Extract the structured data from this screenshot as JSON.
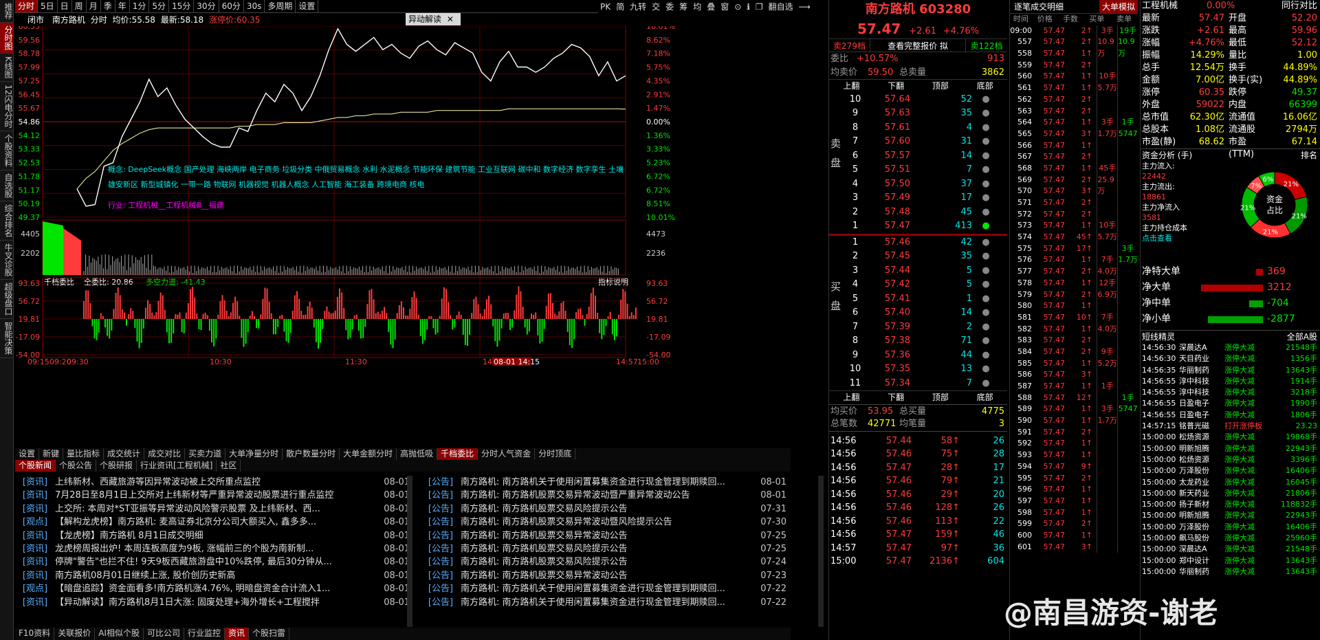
{
  "left_nav": [
    "推荐",
    "分时图",
    "K线图",
    "12闪电分时",
    "个股资料",
    "自选股",
    "综合排名",
    "牛叉诊股",
    "超级盘口",
    "智能决策"
  ],
  "toolbar": [
    "分时",
    "5日",
    "日",
    "周",
    "月",
    "季",
    "年",
    "1分",
    "5分",
    "15分",
    "30分",
    "60分",
    "30s",
    "多周期",
    "设置"
  ],
  "toolbar_right": [
    "PK",
    "简",
    "九转",
    "交",
    "委",
    "筹",
    "均",
    "叠",
    "窗",
    "⊙",
    "ℹ",
    "❐",
    "翻自选",
    "⟶"
  ],
  "chart_header": {
    "status": "闭市",
    "name": "南方路机",
    "mode": "分时",
    "avg_label": "均价:",
    "avg": "55.58",
    "latest_label": "最新:",
    "latest": "58.18",
    "limit": "涨停价:60.35",
    "tag": "异动解读"
  },
  "price_axis_left": [
    "60.35",
    "59.56",
    "58.78",
    "57.99",
    "57.25",
    "56.45",
    "55.67",
    "54.86",
    "54.12",
    "53.33",
    "52.53",
    "51.78",
    "51.17",
    "50.19",
    "49.37"
  ],
  "price_axis_right": [
    "10.01%",
    "8.62%",
    "7.18%",
    "5.75%",
    "4.35%",
    "2.91%",
    "1.47%",
    "0.00%",
    "1.36%",
    "3.33%",
    "5.23%",
    "6.72%",
    "6.72%",
    "8.51%",
    "10.01%"
  ],
  "vol_axis": [
    "4405",
    "2202"
  ],
  "vol_axis_right": [
    "4473",
    "2236"
  ],
  "concepts": "概念: DeepSeek概念  国产处理  海峡两岸  电子商务  垃圾分类  中俄贸易概念  水利  水泥概念  节能环保  建筑节能  工业互联网  碳中和  数字经济  数字孪生  土壤  雄安新区  新型城镇化  一带一路  物联网  机器视觉  机器人概念  人工智能  海工装备  跨境电商  核电",
  "industry": "行业: 工程机械__工程机械Ⅲ__福建",
  "indicator": {
    "title": "千档委比",
    "total": "全委比: 20.86",
    "airflow": "多空力道: -41.43",
    "help": "指标说明"
  },
  "ind_axis": [
    "93.63",
    "56.72",
    "19.81",
    "-17.09",
    "-54.00"
  ],
  "time_axis": [
    "09:15",
    "09:20",
    "09:30",
    "10:30",
    "11:30",
    "14:00",
    "14:57",
    "15:00"
  ],
  "time_hl": "08-01 14:15",
  "tabs_ind": [
    "设置",
    "新键",
    "量比指标",
    "成交统计",
    "成交对比",
    "买卖力道",
    "大单净量分时",
    "散户数量分时",
    "大单金额分时",
    "高抛低吸",
    "千档委比",
    "分时人气资金",
    "分时顶底"
  ],
  "tabs_news": [
    "个股新闻",
    "个股公告",
    "个股研报",
    "行业资讯[工程机械]",
    "社区"
  ],
  "news_left": [
    {
      "t": "资讯",
      "s": "上纬新材、西藏旅游等因异常波动被上交所重点监控",
      "d": "08-01"
    },
    {
      "t": "资讯",
      "s": "7月28日至8月1日上交所对上纬新材等严重异常波动股票进行重点监控",
      "d": "08-01"
    },
    {
      "t": "资讯",
      "s": "上交所: 本周对*ST亚振等异常波动风险警示股票 及上纬新材、西...",
      "d": "08-01"
    },
    {
      "t": "观点",
      "s": "【解构龙虎榜】南方路机: 麦高证券北京分公司大额买入, 鑫多多...",
      "d": "08-01"
    },
    {
      "t": "资讯",
      "s": "【龙虎榜】南方路机 8月1日成交明细",
      "d": "08-01"
    },
    {
      "t": "资讯",
      "s": "龙虎榜周报出炉! 本周连板高度为9板, 涨幅前三的个股为南新制...",
      "d": "08-01"
    },
    {
      "t": "资讯",
      "s": "停牌\"警告\"也拦不住! 9天9板西藏旅游盘中10%跌停, 最后30分钟从...",
      "d": "08-01"
    },
    {
      "t": "资讯",
      "s": "南方路机08月01日继续上涨, 股价创历史新高",
      "d": "08-01"
    },
    {
      "t": "观点",
      "s": "【暗盘追踪】资金面看多!南方路机涨4.76%, 明暗盘资金合计流入1...",
      "d": "08-01"
    },
    {
      "t": "资讯",
      "s": "【异动解读】南方路机8月1日大涨: 固废处理+海外增长+工程搅拌",
      "d": "08-01"
    }
  ],
  "news_right": [
    {
      "t": "公告",
      "s": "南方路机: 南方路机关于使用闲置募集资金进行现金管理到期赎回...",
      "d": "08-01"
    },
    {
      "t": "公告",
      "s": "南方路机: 南方路机股票交易异常波动暨严重异常波动公告",
      "d": "08-01"
    },
    {
      "t": "公告",
      "s": "南方路机: 南方路机股票交易风险提示公告",
      "d": "07-31"
    },
    {
      "t": "公告",
      "s": "南方路机: 南方路机股票交易异常波动暨风险提示公告",
      "d": "07-30"
    },
    {
      "t": "公告",
      "s": "南方路机: 南方路机股票交易异常波动公告",
      "d": "07-25"
    },
    {
      "t": "公告",
      "s": "南方路机: 南方路机股票交易风险提示公告",
      "d": "07-25"
    },
    {
      "t": "公告",
      "s": "南方路机: 南方路机股票交易风险提示公告",
      "d": "07-24"
    },
    {
      "t": "公告",
      "s": "南方路机: 南方路机股票交易异常波动公告",
      "d": "07-23"
    },
    {
      "t": "公告",
      "s": "南方路机: 南方路机关于使用闲置募集资金进行现金管理到期赎回...",
      "d": "07-22"
    },
    {
      "t": "公告",
      "s": "南方路机: 南方路机关于使用闲置募集资金进行现金管理到期赎回...",
      "d": "07-22"
    }
  ],
  "bottom_tabs": [
    "F10资料",
    "关联报价",
    "AI相似个股",
    "可比公司",
    "行业监控",
    "资讯",
    "个股扫雷"
  ],
  "quote": {
    "name": "南方路机 603280",
    "price": "57.47",
    "change": "+2.61",
    "pct": "+4.76%",
    "sell_btn": "卖279档",
    "book_btn": "查看完整报价 拟",
    "buy_btn": "卖122档",
    "webi_label": "委比",
    "webi": "+10.57%",
    "webi_v": "913",
    "sellavg_label": "均卖价",
    "sellavg": "59.50",
    "sellvol_label": "总卖量",
    "sellvol": "3862",
    "cols": [
      "上翻",
      "下翻",
      "顶部",
      "底部"
    ],
    "side_sell": "卖盘",
    "side_buy": "买盘",
    "asks": [
      [
        "10",
        "57.64",
        "52"
      ],
      [
        "9",
        "57.63",
        "35"
      ],
      [
        "8",
        "57.61",
        "4"
      ],
      [
        "7",
        "57.60",
        "31"
      ],
      [
        "6",
        "57.57",
        "14"
      ],
      [
        "5",
        "57.51",
        "7"
      ],
      [
        "4",
        "57.50",
        "37"
      ],
      [
        "3",
        "57.49",
        "17"
      ],
      [
        "2",
        "57.48",
        "45"
      ],
      [
        "1",
        "57.47",
        "413"
      ]
    ],
    "bids": [
      [
        "1",
        "57.46",
        "42"
      ],
      [
        "2",
        "57.45",
        "35"
      ],
      [
        "3",
        "57.44",
        "5"
      ],
      [
        "4",
        "57.42",
        "5"
      ],
      [
        "5",
        "57.41",
        "1"
      ],
      [
        "6",
        "57.40",
        "14"
      ],
      [
        "7",
        "57.39",
        "2"
      ],
      [
        "8",
        "57.38",
        "71"
      ],
      [
        "9",
        "57.36",
        "44"
      ],
      [
        "10",
        "57.35",
        "13"
      ],
      [
        "11",
        "57.34",
        "7"
      ]
    ],
    "buyavg_label": "均买价",
    "buyavg": "53.95",
    "buyvol_label": "总买量",
    "buyvol": "4775",
    "count_label": "总笔数",
    "count": "42771",
    "avgvol_label": "均笔量",
    "avgvol": "3",
    "trades": [
      [
        "14:56",
        "57.44",
        "58",
        "26"
      ],
      [
        "14:56",
        "57.46",
        "75",
        "28"
      ],
      [
        "14:56",
        "57.47",
        "28",
        "17"
      ],
      [
        "14:56",
        "57.46",
        "79",
        "21"
      ],
      [
        "14:56",
        "57.46",
        "29",
        "20"
      ],
      [
        "14:56",
        "57.46",
        "128",
        "26"
      ],
      [
        "14:56",
        "57.46",
        "113",
        "22"
      ],
      [
        "14:56",
        "57.47",
        "159",
        "46"
      ],
      [
        "14:57",
        "57.47",
        "97",
        "36"
      ],
      [
        "15:00",
        "57.47",
        "2136",
        "604"
      ]
    ]
  },
  "ticks": {
    "title": "逐笔成交明细",
    "btn": "大单模拟",
    "cols": [
      "时间",
      "价格",
      "手数",
      "买单",
      "卖单"
    ],
    "rows": [
      [
        "09:00",
        "57.47",
        "2"
      ],
      [
        "557",
        "57.47",
        "2"
      ],
      [
        "558",
        "57.47",
        "1"
      ],
      [
        "559",
        "57.47",
        "2"
      ],
      [
        "560",
        "57.47",
        "1"
      ],
      [
        "561",
        "57.47",
        "1"
      ],
      [
        "562",
        "57.47",
        "2"
      ],
      [
        "563",
        "57.47",
        "2"
      ],
      [
        "564",
        "57.47",
        "1"
      ],
      [
        "565",
        "57.47",
        "3"
      ],
      [
        "566",
        "57.47",
        "1"
      ],
      [
        "567",
        "57.47",
        "2"
      ],
      [
        "568",
        "57.47",
        "1"
      ],
      [
        "569",
        "57.47",
        "2"
      ],
      [
        "570",
        "57.47",
        "3"
      ],
      [
        "571",
        "57.47",
        "2"
      ],
      [
        "572",
        "57.47",
        "2"
      ],
      [
        "573",
        "57.47",
        "1"
      ],
      [
        "574",
        "57.47",
        "45"
      ],
      [
        "575",
        "57.47",
        "17"
      ],
      [
        "576",
        "57.47",
        "1"
      ],
      [
        "577",
        "57.47",
        "2"
      ],
      [
        "578",
        "57.47",
        "1"
      ],
      [
        "579",
        "57.47",
        "2"
      ],
      [
        "580",
        "57.47",
        "1"
      ],
      [
        "581",
        "57.47",
        "10"
      ],
      [
        "582",
        "57.47",
        "1"
      ],
      [
        "583",
        "57.47",
        "2"
      ],
      [
        "584",
        "57.47",
        "2"
      ],
      [
        "585",
        "57.47",
        "1"
      ],
      [
        "586",
        "57.47",
        "3"
      ],
      [
        "587",
        "57.47",
        "1"
      ],
      [
        "588",
        "57.47",
        "12"
      ],
      [
        "589",
        "57.47",
        "1"
      ],
      [
        "590",
        "57.47",
        "1"
      ],
      [
        "591",
        "57.47",
        "2"
      ],
      [
        "592",
        "57.47",
        "1"
      ],
      [
        "593",
        "57.47",
        "1"
      ],
      [
        "594",
        "57.47",
        "9"
      ],
      [
        "595",
        "57.47",
        "2"
      ],
      [
        "596",
        "57.47",
        "1"
      ],
      [
        "597",
        "57.47",
        "1"
      ],
      [
        "598",
        "57.47",
        "1"
      ],
      [
        "599",
        "57.47",
        "2"
      ],
      [
        "600",
        "57.47",
        "1"
      ],
      [
        "601",
        "57.47",
        "3"
      ]
    ],
    "buys": [
      "3手",
      "10.9万",
      "",
      "",
      "10手",
      "5.7万",
      "",
      "",
      "3手",
      "1.7万",
      "",
      "",
      "45手",
      "25.9万",
      "",
      "",
      "",
      "10手",
      "5.7万",
      "",
      "7手",
      "4.0万",
      "12手",
      "6.9万",
      "",
      "7手",
      "4.0万",
      "",
      "9手",
      "5.2万",
      "",
      "1手",
      "",
      "3手",
      "1.7万"
    ],
    "sells": [
      "19手",
      "10.9万",
      "",
      "",
      "",
      "",
      "",
      "",
      "1手",
      "5747",
      "",
      "",
      "",
      "",
      "",
      "",
      "",
      "",
      "",
      "3手",
      "1.7万",
      "",
      "",
      "",
      "",
      "",
      "",
      "",
      "",
      "",
      "",
      "",
      "1手",
      "5747",
      "",
      "",
      ""
    ]
  },
  "info": {
    "title": "工程机械",
    "title_pct": "0.00%",
    "title_r": "同行对比",
    "rows": [
      [
        "最新",
        "57.47",
        "开盘",
        "52.20"
      ],
      [
        "涨跌",
        "+2.61",
        "最高",
        "59.96"
      ],
      [
        "涨幅",
        "+4.76%",
        "最低",
        "52.12"
      ],
      [
        "振幅",
        "14.29%",
        "量比",
        "1.00"
      ],
      [
        "总手",
        "12.54万",
        "换手",
        "44.89%"
      ],
      [
        "金额",
        "7.00亿",
        "换手(实)",
        "44.89%"
      ],
      [
        "涨停",
        "60.35",
        "跌停",
        "49.37"
      ],
      [
        "外盘",
        "59022",
        "内盘",
        "66399"
      ],
      [
        "总市值",
        "62.30亿",
        "流通值",
        "16.06亿"
      ],
      [
        "总股本",
        "1.08亿",
        "流通股",
        "2794万"
      ],
      [
        "市盈(静)",
        "68.62",
        "市盈(TTM)",
        "67.14"
      ]
    ],
    "flow_title": "资金分析 (手)",
    "flow_r": "排名",
    "flow_items": [
      [
        "主力流入:",
        "22442"
      ],
      [
        "主力流出:",
        "18861"
      ],
      [
        "主力净流入",
        "3581"
      ],
      [
        "主力持仓成本",
        ""
      ]
    ],
    "flow_link": "点击查看",
    "donut": {
      "center1": "资金",
      "center2": "占比",
      "segs": [
        {
          "v": 21,
          "c": "#cc0000",
          "l": "21%"
        },
        {
          "v": 21,
          "c": "#009900",
          "l": "21%"
        },
        {
          "v": 21,
          "c": "#ff3030",
          "l": "21%"
        },
        {
          "v": 21,
          "c": "#00bb00",
          "l": "21%"
        },
        {
          "v": 8,
          "c": "#ff5050",
          "l": "7%"
        },
        {
          "v": 8,
          "c": "#00cc00",
          "l": "6%"
        }
      ]
    },
    "net": [
      [
        "净特大单",
        "369",
        0.1,
        "r"
      ],
      [
        "净大单",
        "3212",
        0.9,
        "r"
      ],
      [
        "净中单",
        "-704",
        0.2,
        "g"
      ],
      [
        "净小单",
        "-2877",
        0.8,
        "g"
      ]
    ],
    "sprite_title": "短线精灵",
    "sprite_r": "全部A股",
    "sprites": [
      [
        "14:56:30",
        "深晨达A",
        "涨停大减",
        "21548手"
      ],
      [
        "14:56:30",
        "天目药业",
        "涨停大减",
        "1356手"
      ],
      [
        "14:56:35",
        "华丽制药",
        "涨停大减",
        "13643手"
      ],
      [
        "14:56:55",
        "淳中科技",
        "涨停大减",
        "1914手"
      ],
      [
        "14:56:55",
        "淳中科技",
        "涨停大减",
        "3218手"
      ],
      [
        "14:56:55",
        "日盈电子",
        "涨停大减",
        "1990手"
      ],
      [
        "14:56:55",
        "日盈电子",
        "涨停大减",
        "1806手"
      ],
      [
        "14:57:15",
        "铭普光磁",
        "打开涨停板",
        "23.23"
      ],
      [
        "15:00:00",
        "松炀资源",
        "涨停大减",
        "19868手"
      ],
      [
        "15:00:00",
        "明新旭腾",
        "涨停大减",
        "22943手"
      ],
      [
        "15:00:00",
        "松炀资源",
        "涨停大减",
        "3396手"
      ],
      [
        "15:00:00",
        "万泽股份",
        "涨停大减",
        "16406手"
      ],
      [
        "15:00:00",
        "太龙药业",
        "涨停大减",
        "16045手"
      ],
      [
        "15:00:00",
        "新天药业",
        "涨停大减",
        "21806手"
      ],
      [
        "15:00:00",
        "扬子新材",
        "涨停大减",
        "118832手"
      ],
      [
        "15:00:00",
        "明新旭腾",
        "涨停大减",
        "22943手"
      ],
      [
        "15:00:00",
        "万泽股份",
        "涨停大减",
        "16406手"
      ],
      [
        "15:00:00",
        "飙马股份",
        "涨停大减",
        "25960手"
      ],
      [
        "15:00:00",
        "深晨达A",
        "涨停大减",
        "21548手"
      ],
      [
        "15:00:00",
        "郑中设计",
        "涨停大减",
        "13643手"
      ],
      [
        "15:00:00",
        "华丽制药",
        "涨停大减",
        "13643手"
      ]
    ]
  },
  "watermark": "@南昌游资-谢老",
  "chart_data": {
    "type": "line",
    "title": "南方路机 分时",
    "ylim": [
      49.37,
      60.35
    ],
    "series": [
      {
        "name": "价格",
        "values": [
          51.0,
          50.0,
          50.1,
          52.3,
          52.5,
          54.0,
          55.0,
          56.0,
          57.3,
          56.3,
          56.8,
          55.8,
          55.0,
          54.5,
          54.0,
          53.6,
          53.4,
          53.4,
          54.5,
          54.3,
          55.5,
          56.5,
          56.0,
          57.0,
          56.5,
          55.5,
          56.3,
          57.5,
          59.0,
          60.2,
          59.3,
          58.9,
          59.3,
          59.7,
          59.0,
          59.3,
          58.8,
          58.5,
          59.2,
          59.5,
          59.0,
          58.7,
          59.4,
          59.1,
          58.8,
          57.7,
          57.2,
          58.3,
          58.9,
          58.0,
          58.0,
          57.7,
          58.0,
          58.5,
          58.8,
          59.3,
          59.1,
          58.6,
          57.5,
          58.3,
          57.2,
          57.5
        ]
      },
      {
        "name": "均价",
        "values": [
          51.0,
          51.6,
          52.0,
          52.6,
          53.2,
          53.6,
          53.9,
          54.2,
          54.4,
          54.5,
          54.5,
          54.5,
          54.5,
          54.5,
          54.5,
          54.5,
          54.5,
          54.5,
          54.6,
          54.6,
          54.7,
          54.7,
          54.7,
          54.8,
          54.8,
          54.8,
          54.8,
          54.9,
          55.0,
          55.1,
          55.1,
          55.2,
          55.2,
          55.3,
          55.3,
          55.3,
          55.4,
          55.4,
          55.4,
          55.4,
          55.5,
          55.5,
          55.5,
          55.5,
          55.5,
          55.5,
          55.5,
          55.5,
          55.6,
          55.6,
          55.6,
          55.6,
          55.6,
          55.6,
          55.6,
          55.6,
          55.6,
          55.6,
          55.6,
          55.6,
          55.6,
          55.58
        ]
      }
    ]
  }
}
